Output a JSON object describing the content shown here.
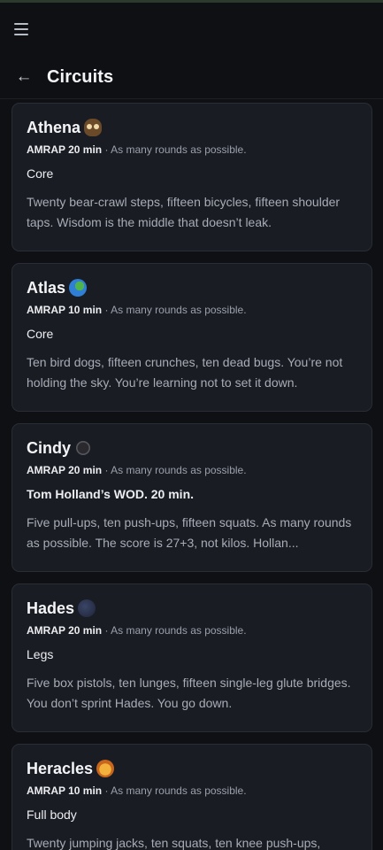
{
  "header": {
    "title": "Circuits"
  },
  "cards": [
    {
      "name": "Athena",
      "emoji": "owl-icon",
      "format": "AMRAP 20 min",
      "format_note": "· As many rounds as possible.",
      "focus": "Core",
      "description": "Twenty bear-crawl steps, fifteen bicycles, fifteen shoulder taps. Wisdom is the middle that doesn’t leak."
    },
    {
      "name": "Atlas",
      "emoji": "globe-icon",
      "format": "AMRAP 10 min",
      "format_note": "· As many rounds as possible.",
      "focus": "Core",
      "description": "Ten bird dogs, fifteen crunches, ten dead bugs. You’re not holding the sky. You’re learning not to set it down."
    },
    {
      "name": "Cindy",
      "emoji": "spider-icon",
      "format": "AMRAP 20 min",
      "format_note": "· As many rounds as possible.",
      "focus": "Tom Holland’s WOD. 20 min.",
      "description": "Five pull-ups, ten push-ups, fifteen squats. As many rounds as possible. The score is 27+3, not kilos. Hollan..."
    },
    {
      "name": "Hades",
      "emoji": "moon-icon",
      "format": "AMRAP 20 min",
      "format_note": "· As many rounds as possible.",
      "focus": "Legs",
      "description": "Five box pistols, ten lunges, fifteen single-leg glute bridges. You don’t sprint Hades. You go down."
    },
    {
      "name": "Heracles",
      "emoji": "lion-icon",
      "format": "AMRAP 10 min",
      "format_note": "· As many rounds as possible.",
      "focus": "Full body",
      "description": "Twenty jumping jacks, ten squats, ten knee push-ups,"
    }
  ]
}
